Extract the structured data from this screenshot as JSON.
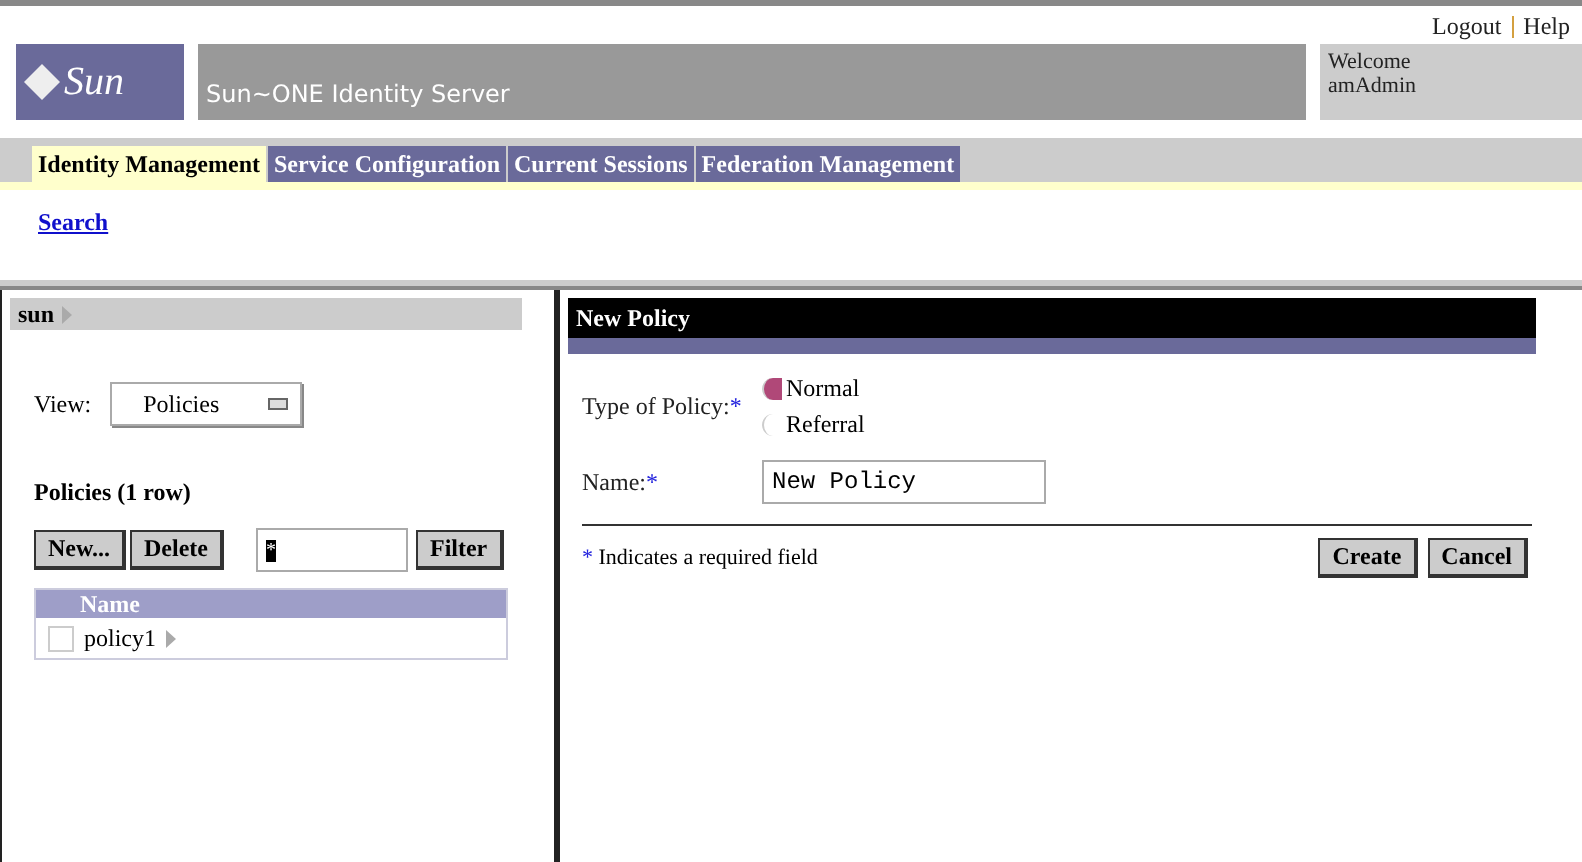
{
  "header": {
    "logo": "Sun",
    "product": "Sun~ONE Identity Server",
    "links": [
      "Logout",
      "Help"
    ],
    "welcome": "Welcome",
    "user": "amAdmin"
  },
  "tabs": [
    {
      "label": "Identity Management",
      "selected": true
    },
    {
      "label": "Service Configuration",
      "selected": false
    },
    {
      "label": "Current Sessions",
      "selected": false
    },
    {
      "label": "Federation Management",
      "selected": false
    }
  ],
  "subnav": {
    "link": "Search"
  },
  "left": {
    "breadcrumb": "sun",
    "view_label": "View:",
    "view_value": "Policies",
    "list_title": "Policies (1 row)",
    "buttons": [
      "New...",
      "Delete"
    ],
    "filter_value": "*",
    "filter_button": "Filter",
    "column": "Name",
    "rows": [
      {
        "name": "policy1",
        "checked": false
      }
    ]
  },
  "right": {
    "title": "New Policy",
    "type_label": "Type of Policy:",
    "required_mark": "*",
    "options": [
      {
        "label": "Normal",
        "selected": true
      },
      {
        "label": "Referral",
        "selected": false
      }
    ],
    "name_label": "Name:",
    "name_value": "New Policy",
    "note_mark": "*",
    "note": "Indicates a required field",
    "buttons": [
      "Create",
      "Cancel"
    ]
  }
}
